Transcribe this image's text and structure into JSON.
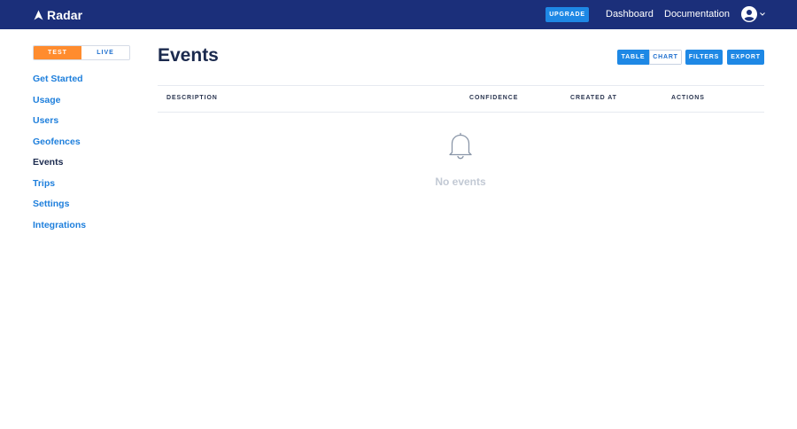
{
  "header": {
    "logo_text": "Radar",
    "upgrade_label": "UPGRADE",
    "nav": {
      "dashboard": "Dashboard",
      "documentation": "Documentation"
    }
  },
  "env_toggle": {
    "test_label": "TEST",
    "live_label": "LIVE",
    "selected": "TEST"
  },
  "sidebar": {
    "items": [
      {
        "label": "Get Started"
      },
      {
        "label": "Usage"
      },
      {
        "label": "Users"
      },
      {
        "label": "Geofences"
      },
      {
        "label": "Events"
      },
      {
        "label": "Trips"
      },
      {
        "label": "Settings"
      },
      {
        "label": "Integrations"
      }
    ],
    "active": "Events"
  },
  "main": {
    "title": "Events",
    "actions": {
      "table": "TABLE",
      "chart": "CHART",
      "filters": "FILTERS",
      "export": "EXPORT"
    },
    "table": {
      "columns": [
        "DESCRIPTION",
        "CONFIDENCE",
        "CREATED AT",
        "ACTIONS"
      ]
    },
    "empty_state": {
      "icon": "bell-icon",
      "text": "No events"
    }
  },
  "colors": {
    "header_bg": "#1b2f7a",
    "accent_blue": "#1e88e5",
    "test_orange": "#ff8c2e",
    "nav_link_blue": "#1e7fdc",
    "muted_text": "#c2c9d4"
  }
}
